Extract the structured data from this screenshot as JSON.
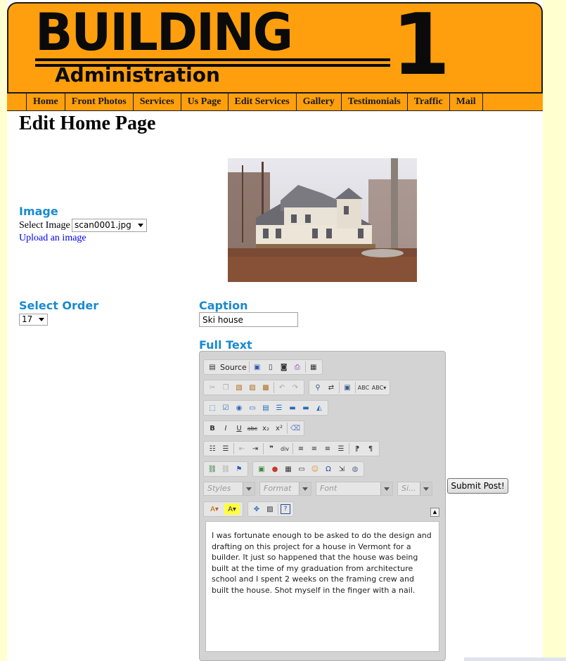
{
  "header": {
    "logo_main": "BUILDING",
    "logo_number": "1",
    "subtitle": "Administration"
  },
  "nav": {
    "items": [
      "Home",
      "Front Photos",
      "Services",
      "Us Page",
      "Edit Services",
      "Gallery",
      "Testimonials",
      "Traffic",
      "Mail"
    ]
  },
  "page_title": "Edit Home Page",
  "image_section": {
    "heading": "Image",
    "select_label": "Select Image",
    "selected_file": "scan0001.jpg",
    "upload_link": "Upload an image"
  },
  "order_section": {
    "heading": "Select Order",
    "selected_value": "17"
  },
  "caption_section": {
    "heading": "Caption",
    "value": "Ski house"
  },
  "full_text_section": {
    "heading": "Full Text",
    "toolbar": {
      "source_label": "Source",
      "styles_placeholder": "Styles",
      "format_placeholder": "Format",
      "font_placeholder": "Font",
      "size_placeholder": "Si..."
    },
    "content": "I was fortunate enough to be asked to do the design and drafting on this project for a house in Vermont for a builder. It just so happened that the house was being built at the time of my graduation from architecture school and I spent 2 weeks on the framing crew and built the house. Shot myself in the finger with a nail."
  },
  "submit_button": "Submit Post!",
  "colors": {
    "brand_orange": "#ff9f0d",
    "heading_blue": "#1a8ad0",
    "link_blue": "#0000ee",
    "background_cream": "#ffffd0"
  }
}
